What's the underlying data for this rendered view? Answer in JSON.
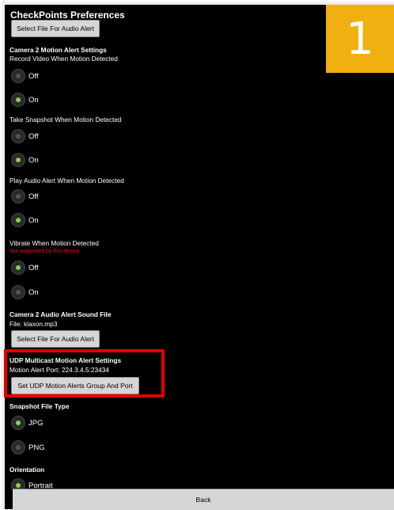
{
  "title": "CheckPoints Preferences",
  "badge": "1",
  "top_button": "Select File For Audio Alert",
  "camera2_motion": {
    "heading": "Camera 2 Motion Alert Settings",
    "record_video": {
      "label": "Record Video When Motion Detected",
      "off": "Off",
      "on": "On"
    },
    "snapshot": {
      "label": "Take Snapshot When Motion Detected",
      "off": "Off",
      "on": "On"
    },
    "audio": {
      "label": "Play Audio Alert When Motion Detected",
      "off": "Off",
      "on": "On"
    },
    "vibrate": {
      "label": "Vibrate When Motion Detected",
      "note": "Not supported by this device",
      "off": "Off",
      "on": "On"
    }
  },
  "camera2_audio": {
    "heading": "Camera 2 Audio Alert Sound File",
    "file": "File: klaxon.mp3",
    "button": "Select File For Audio Alert"
  },
  "udp": {
    "heading": "UDP Multicast Motion Alert Settings",
    "port": "Motion Alert Port: 224.3.4.5:23434",
    "button": "Set UDP Motion Alerts Group And Port"
  },
  "snapshot_type": {
    "heading": "Snapshot File Type",
    "jpg": "JPG",
    "png": "PNG"
  },
  "orientation": {
    "heading": "Orientation",
    "portrait": "Portrait"
  },
  "back": "Back",
  "colors": {
    "accent": "#8bd24a",
    "highlight": "#e30000",
    "badge": "#f0b010",
    "warning": "#e11111"
  }
}
